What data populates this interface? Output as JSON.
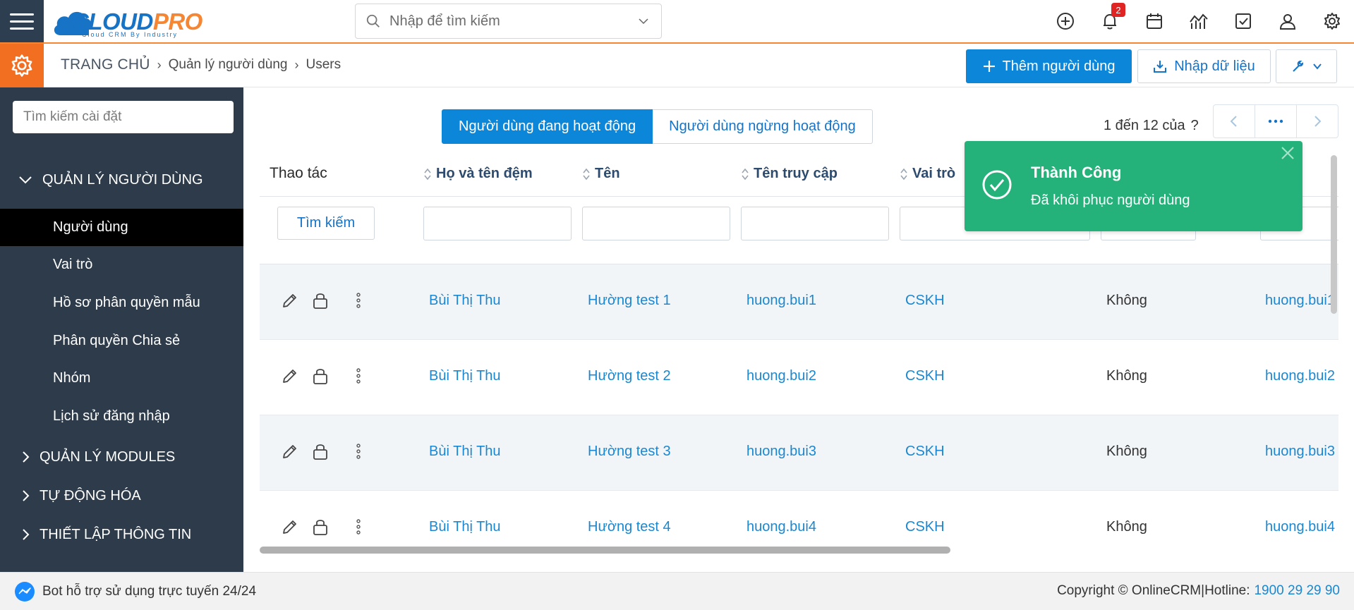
{
  "brand": {
    "name_main": "CLOUD",
    "name_accent": "PRO",
    "tagline": "Cloud CRM By Industry",
    "primary": "#1673c6",
    "accent": "#f58634"
  },
  "search": {
    "placeholder": "Nhập để tìm kiếm"
  },
  "top_icons": [
    "add-circle-icon",
    "bell-icon",
    "calendar-icon",
    "chart-icon",
    "task-icon",
    "user-icon",
    "gear-icon"
  ],
  "notifications": {
    "count": "2"
  },
  "breadcrumb": {
    "home": "TRANG CHỦ",
    "section": "Quản lý người dùng",
    "page": "Users"
  },
  "actions": {
    "add_user": "Thêm người dùng",
    "import": "Nhập dữ liệu"
  },
  "sidebar": {
    "search_placeholder": "Tìm kiếm cài đặt",
    "group_main": "QUẢN LÝ NGƯỜI DÙNG",
    "items": [
      {
        "label": "Người dùng",
        "active": true
      },
      {
        "label": "Vai trò"
      },
      {
        "label": "Hồ sơ phân quyền mẫu"
      },
      {
        "label": "Phân quyền Chia sẻ"
      },
      {
        "label": "Nhóm"
      },
      {
        "label": "Lịch sử đăng nhập"
      }
    ],
    "groups": [
      "QUẢN LÝ MODULES",
      "TỰ ĐỘNG HÓA",
      "THIẾT LẬP THÔNG TIN"
    ]
  },
  "tabs": {
    "active": "Người dùng đang hoạt động",
    "inactive": "Người dùng ngừng hoạt động"
  },
  "pager": {
    "text": "1 đến 12 của",
    "help": "?"
  },
  "table": {
    "headers": {
      "actions": "Thao tác",
      "middle_name": "Họ và tên đệm",
      "first_name": "Tên",
      "username": "Tên truy cập",
      "role": "Vai trò",
      "email_partial": "il"
    },
    "filter_button": "Tìm kiếm",
    "rows": [
      {
        "middle_name": "Bùi Thị Thu",
        "first_name": "Hường test 1",
        "username": "huong.bui1",
        "role": "CSKH",
        "admin": "Không",
        "email": "huong.bui1"
      },
      {
        "middle_name": "Bùi Thị Thu",
        "first_name": "Hường test 2",
        "username": "huong.bui2",
        "role": "CSKH",
        "admin": "Không",
        "email": "huong.bui2"
      },
      {
        "middle_name": "Bùi Thị Thu",
        "first_name": "Hường test 3",
        "username": "huong.bui3",
        "role": "CSKH",
        "admin": "Không",
        "email": "huong.bui3"
      },
      {
        "middle_name": "Bùi Thị Thu",
        "first_name": "Hường test 4",
        "username": "huong.bui4",
        "role": "CSKH",
        "admin": "Không",
        "email": "huong.bui4"
      }
    ]
  },
  "toast": {
    "title": "Thành Công",
    "message": "Đã khôi phục người dùng",
    "color": "#25b27a"
  },
  "footer": {
    "bot": "Bot hỗ trợ sử dụng trực tuyến 24/24",
    "copyright": "Copyright © OnlineCRM|Hotline:",
    "hotline": "1900 29 29 90"
  }
}
